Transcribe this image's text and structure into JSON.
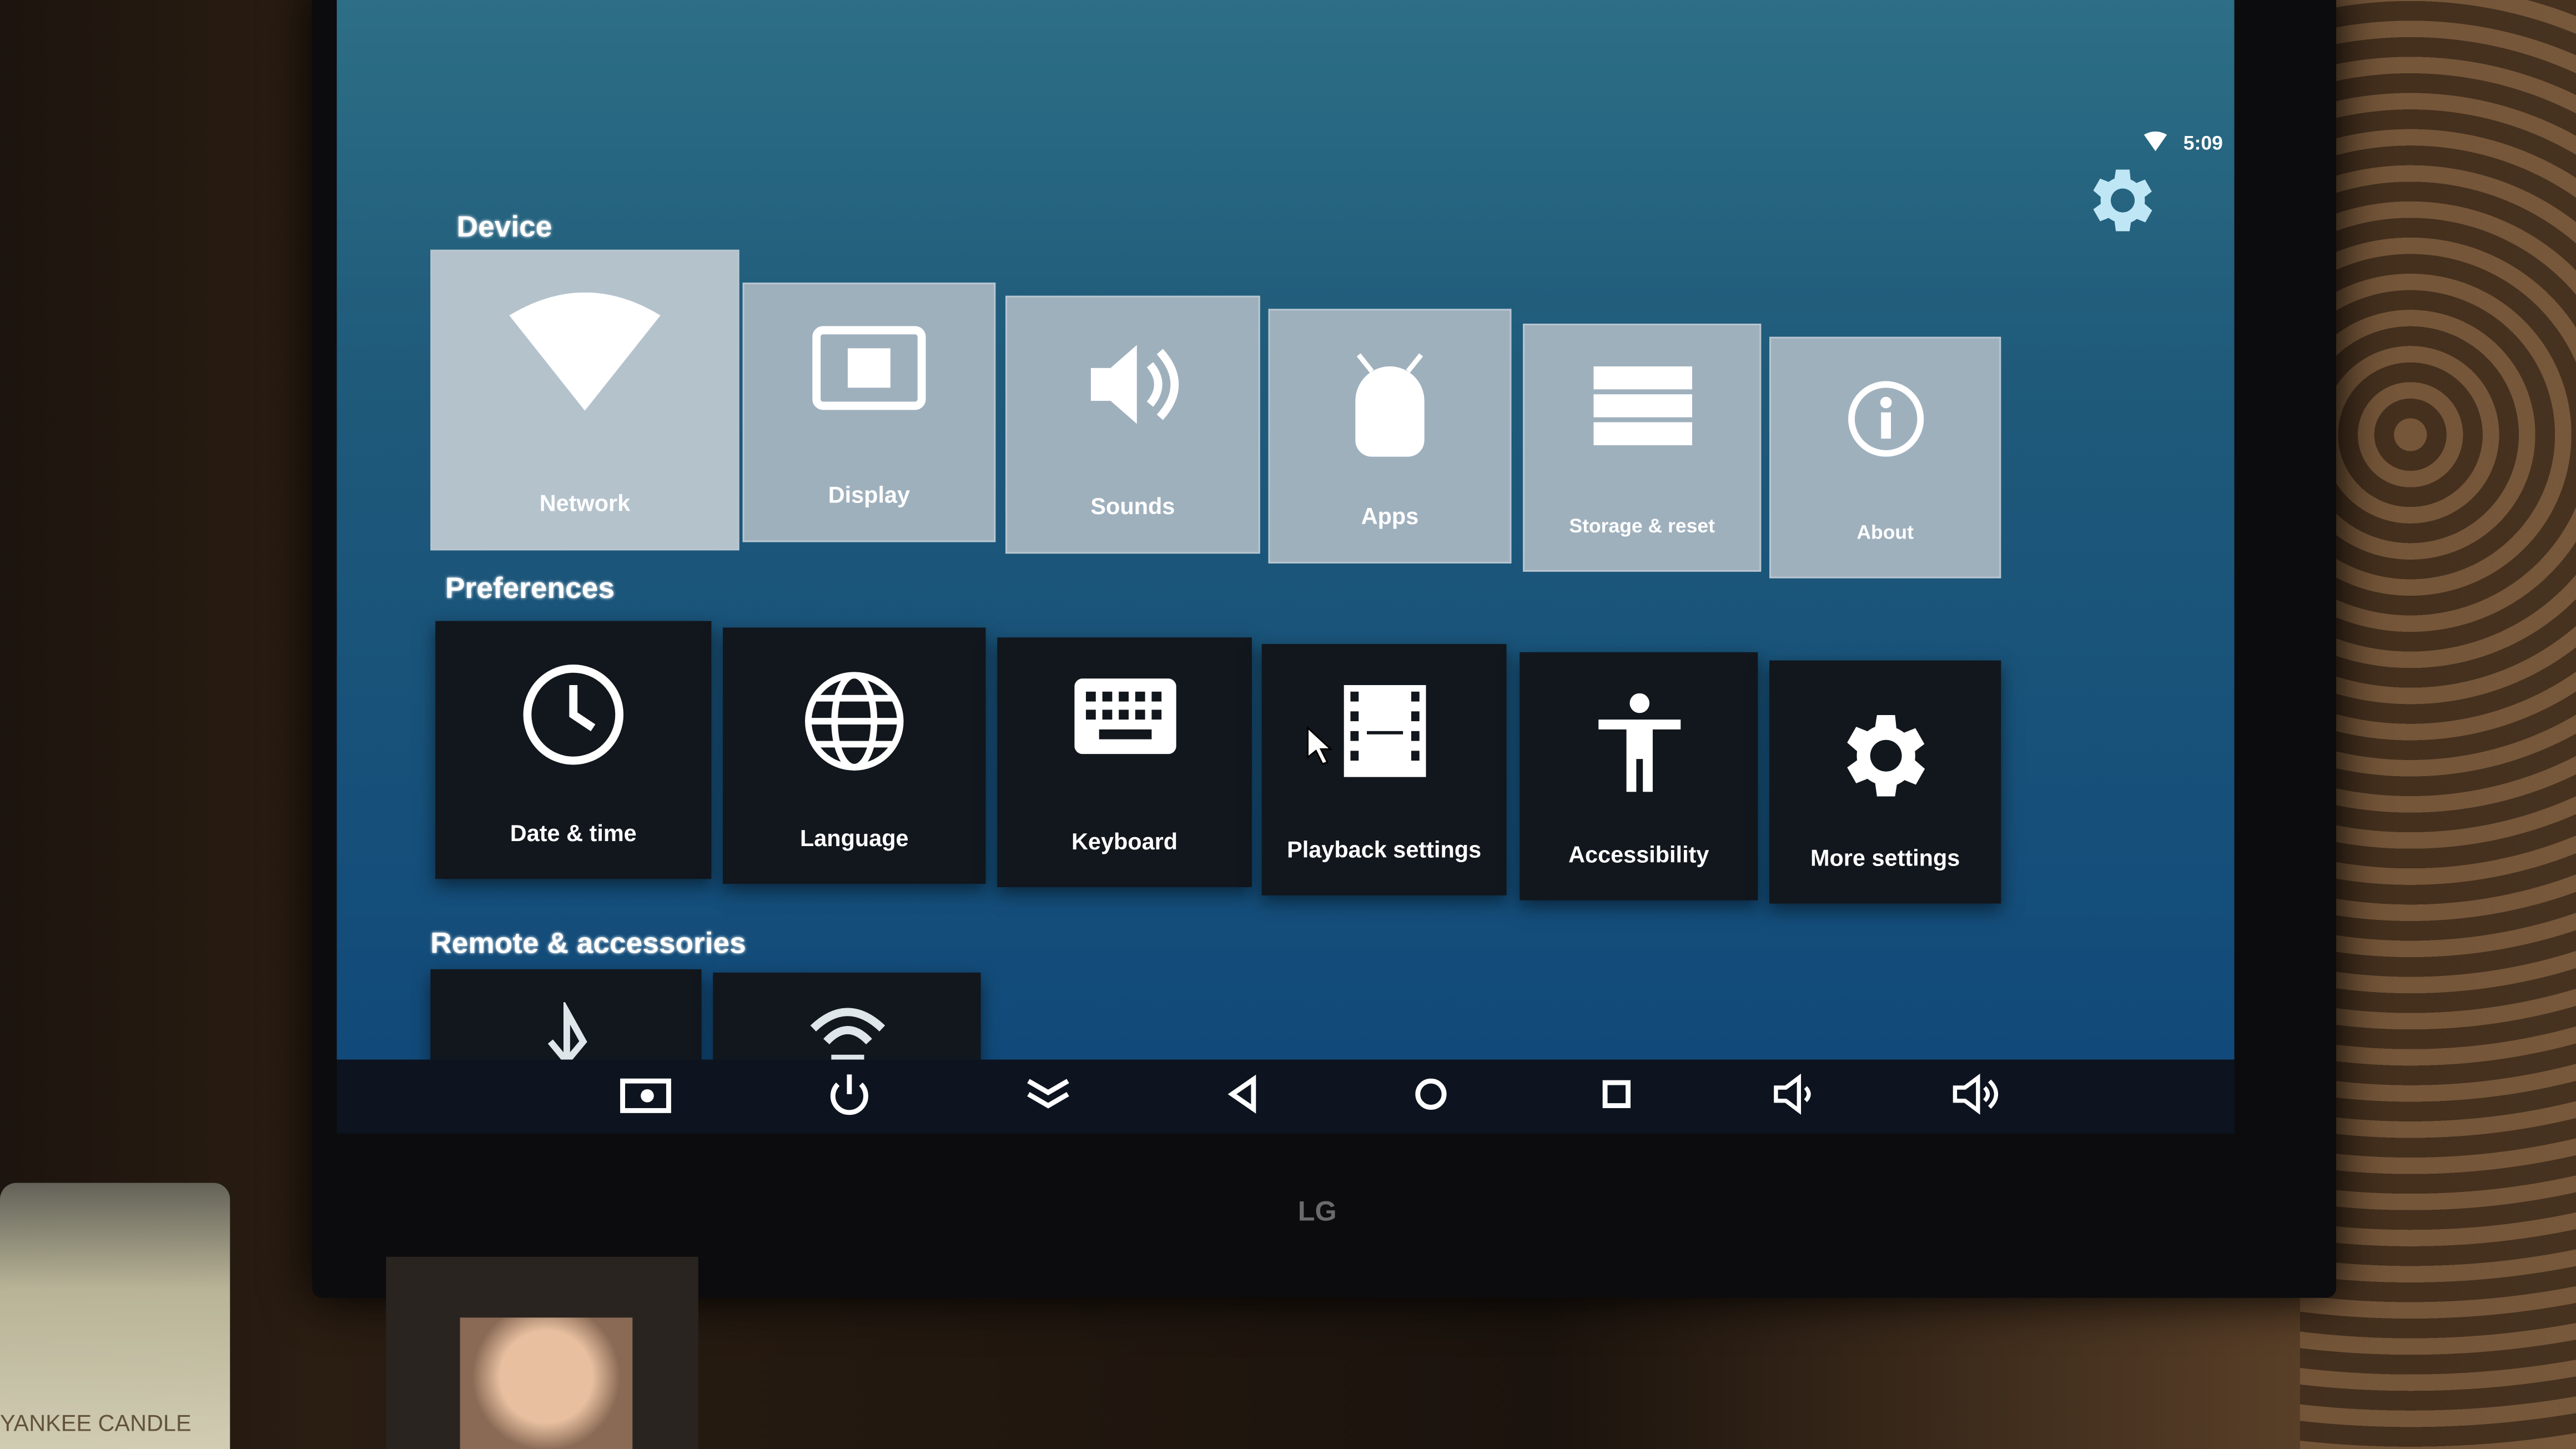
{
  "status": {
    "time": "5:09",
    "wifi_icon": "wifi-icon"
  },
  "sections": {
    "device": {
      "title": "Device",
      "items": [
        {
          "label": "Network",
          "icon": "wifi-icon"
        },
        {
          "label": "Display",
          "icon": "display-icon"
        },
        {
          "label": "Sounds",
          "icon": "speaker-icon"
        },
        {
          "label": "Apps",
          "icon": "android-icon"
        },
        {
          "label": "Storage & reset",
          "icon": "storage-icon"
        },
        {
          "label": "About",
          "icon": "info-icon"
        }
      ]
    },
    "preferences": {
      "title": "Preferences",
      "items": [
        {
          "label": "Date & time",
          "icon": "clock-icon"
        },
        {
          "label": "Language",
          "icon": "globe-icon"
        },
        {
          "label": "Keyboard",
          "icon": "keyboard-icon"
        },
        {
          "label": "Playback settings",
          "icon": "film-icon"
        },
        {
          "label": "Accessibility",
          "icon": "accessibility-icon"
        },
        {
          "label": "More settings",
          "icon": "gear-icon"
        }
      ]
    },
    "remote": {
      "title": "Remote & accessories",
      "items": [
        {
          "icon": "bluetooth-icon"
        },
        {
          "icon": "remote-signal-icon"
        }
      ]
    }
  },
  "navbar": [
    "screenshot-icon",
    "power-icon",
    "collapse-icon",
    "back-icon",
    "home-icon",
    "recents-icon",
    "volume-down-icon",
    "volume-up-icon"
  ],
  "brand": {
    "tv_logo": "LG",
    "candle_text": "YANKEE CANDLE"
  },
  "colors": {
    "screen_top": "#2d6f86",
    "screen_bottom": "#114a7a",
    "device_tile": "#9fb0bd",
    "pref_tile": "#12171d"
  }
}
